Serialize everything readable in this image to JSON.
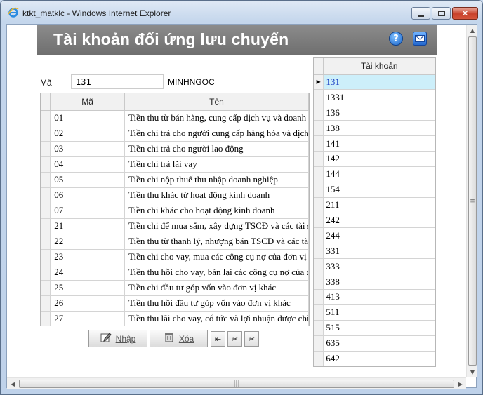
{
  "window": {
    "title": "ktkt_matklc - Windows Internet Explorer"
  },
  "banner": {
    "title": "Tài khoản đối ứng lưu chuyển"
  },
  "filter": {
    "label": "Mã",
    "value": "131",
    "name": "MINHNGOC"
  },
  "grid": {
    "columns": [
      "Mã",
      "Tên"
    ],
    "rows": [
      {
        "ma": "01",
        "ten": "Tiền thu từ bán hàng, cung cấp dịch vụ và doanh thu khác"
      },
      {
        "ma": "02",
        "ten": "Tiền chi trả cho người cung cấp hàng hóa và dịch vụ"
      },
      {
        "ma": "03",
        "ten": "Tiền chi trả cho người lao động"
      },
      {
        "ma": "04",
        "ten": "Tiền chi trả lãi vay"
      },
      {
        "ma": "05",
        "ten": "Tiền chi nộp thuế thu nhập doanh nghiệp"
      },
      {
        "ma": "06",
        "ten": "Tiền thu khác từ hoạt động kinh doanh"
      },
      {
        "ma": "07",
        "ten": "Tiền chi khác cho hoạt động kinh doanh"
      },
      {
        "ma": "21",
        "ten": "Tiền chi để mua sắm, xây dựng TSCĐ và các tài sản dài hạn khác"
      },
      {
        "ma": "22",
        "ten": "Tiền thu từ thanh lý, nhượng bán TSCĐ và các tài sản dài hạn khác"
      },
      {
        "ma": "23",
        "ten": "Tiền chi cho vay, mua các công cụ nợ của đơn vị khác"
      },
      {
        "ma": "24",
        "ten": "Tiền thu hồi cho vay, bán lại các công cụ nợ của đơn vị khác"
      },
      {
        "ma": "25",
        "ten": "Tiền chi đầu tư góp vốn vào đơn vị khác"
      },
      {
        "ma": "26",
        "ten": "Tiền thu hồi đầu tư góp vốn vào đơn vị khác"
      },
      {
        "ma": "27",
        "ten": "Tiền thu lãi cho vay, cổ tức và lợi nhuận được chia"
      }
    ]
  },
  "buttons": {
    "nhap": "Nhập",
    "xoa": "Xóa"
  },
  "accounts": {
    "header": "Tài khoản",
    "selected": "131",
    "items": [
      "131",
      "1331",
      "136",
      "138",
      "141",
      "142",
      "144",
      "154",
      "211",
      "242",
      "244",
      "331",
      "333",
      "338",
      "413",
      "511",
      "515",
      "635",
      "642"
    ]
  }
}
